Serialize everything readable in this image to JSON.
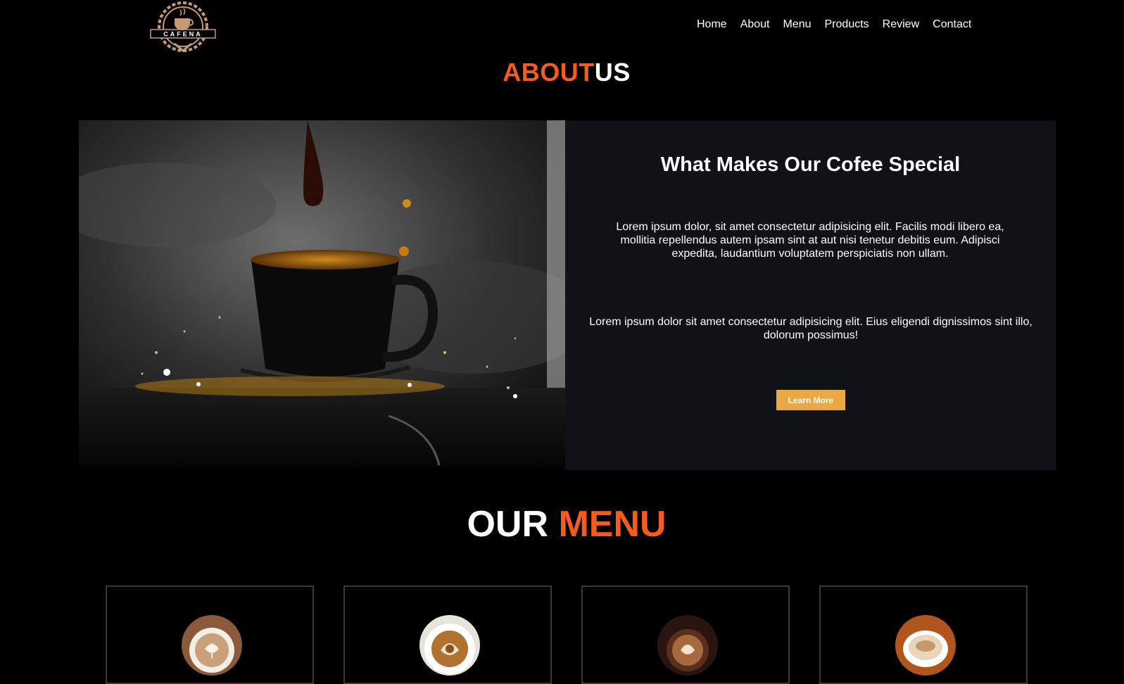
{
  "header": {
    "logo_text": "CAFENA",
    "nav": [
      "Home",
      "About",
      "Menu",
      "Products",
      "Review",
      "Contact"
    ]
  },
  "about": {
    "title_accent": "ABOUT",
    "title_rest": "US",
    "image_alt": "coffee-splash-photo",
    "card": {
      "heading": "What Makes Our Cofee Special",
      "paragraph1": "Lorem ipsum dolor, sit amet consectetur adipisicing elit. Facilis modi libero ea, mollitia repellendus autem ipsam sint at aut nisi tenetur debitis eum. Adipisci expedita, laudantium voluptatem perspiciatis non ullam.",
      "paragraph2": "Lorem ipsum dolor sit amet consectetur adipisicing elit. Eius eligendi dignissimos sint illo, dolorum possimus!",
      "button": "Learn More"
    }
  },
  "menu": {
    "title_plain": "OUR",
    "title_accent": "MENU",
    "items": [
      {
        "image": "latte-art-cup"
      },
      {
        "image": "cappuccino-cup"
      },
      {
        "image": "flat-white-cup"
      },
      {
        "image": "espresso-cup"
      }
    ]
  },
  "colors": {
    "accent": "#f55b1f",
    "button": "#e9a844",
    "card_bg": "#101217",
    "page_bg": "#000000"
  }
}
